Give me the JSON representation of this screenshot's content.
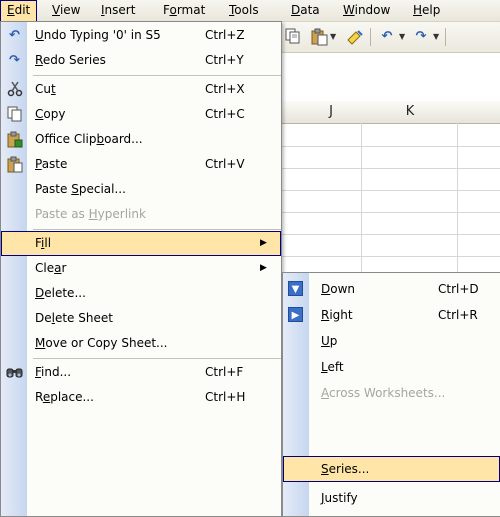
{
  "menubar": {
    "items": [
      {
        "pre": "",
        "key": "E",
        "post": "dit"
      },
      {
        "pre": "",
        "key": "V",
        "post": "iew"
      },
      {
        "pre": "",
        "key": "I",
        "post": "nsert"
      },
      {
        "pre": "F",
        "key": "o",
        "post": "rmat"
      },
      {
        "pre": "",
        "key": "T",
        "post": "ools"
      },
      {
        "pre": "",
        "key": "D",
        "post": "ata"
      },
      {
        "pre": "",
        "key": "W",
        "post": "indow"
      },
      {
        "pre": "",
        "key": "H",
        "post": "elp"
      }
    ]
  },
  "sheet": {
    "columns": [
      "J",
      "K"
    ]
  },
  "edit_menu": {
    "items": [
      {
        "icon": "undo-icon",
        "pre": "",
        "key": "U",
        "post": "ndo Typing '0' in S5",
        "shortcut": "Ctrl+Z"
      },
      {
        "icon": "redo-icon",
        "pre": "",
        "key": "R",
        "post": "edo Series",
        "shortcut": "Ctrl+Y"
      },
      {
        "icon": "cut-icon",
        "pre": "Cu",
        "key": "t",
        "post": "",
        "shortcut": "Ctrl+X"
      },
      {
        "icon": "copy-icon",
        "pre": "",
        "key": "C",
        "post": "opy",
        "shortcut": "Ctrl+C"
      },
      {
        "icon": "office-clipboard-icon",
        "pre": "Office Clip",
        "key": "b",
        "post": "oard...",
        "shortcut": ""
      },
      {
        "icon": "paste-icon",
        "pre": "",
        "key": "P",
        "post": "aste",
        "shortcut": "Ctrl+V"
      },
      {
        "icon": "",
        "pre": "Paste ",
        "key": "S",
        "post": "pecial...",
        "shortcut": ""
      },
      {
        "icon": "",
        "pre": "Paste as ",
        "key": "H",
        "post": "yperlink",
        "shortcut": "",
        "disabled": true
      },
      {
        "icon": "",
        "pre": "F",
        "key": "i",
        "post": "ll",
        "shortcut": "",
        "submenu": true,
        "highlighted": true
      },
      {
        "icon": "",
        "pre": "Cle",
        "key": "a",
        "post": "r",
        "shortcut": "",
        "submenu": true
      },
      {
        "icon": "",
        "pre": "",
        "key": "D",
        "post": "elete...",
        "shortcut": ""
      },
      {
        "icon": "",
        "pre": "De",
        "key": "l",
        "post": "ete Sheet",
        "shortcut": ""
      },
      {
        "icon": "",
        "pre": "",
        "key": "M",
        "post": "ove or Copy Sheet...",
        "shortcut": ""
      },
      {
        "icon": "find-icon",
        "pre": "",
        "key": "F",
        "post": "ind...",
        "shortcut": "Ctrl+F"
      },
      {
        "icon": "",
        "pre": "R",
        "key": "e",
        "post": "place...",
        "shortcut": "Ctrl+H"
      }
    ]
  },
  "fill_submenu": {
    "items": [
      {
        "icon": "fill-down-icon",
        "pre": "",
        "key": "D",
        "post": "own",
        "shortcut": "Ctrl+D"
      },
      {
        "icon": "fill-right-icon",
        "pre": "",
        "key": "R",
        "post": "ight",
        "shortcut": "Ctrl+R"
      },
      {
        "icon": "",
        "pre": "",
        "key": "U",
        "post": "p",
        "shortcut": ""
      },
      {
        "icon": "",
        "pre": "",
        "key": "L",
        "post": "eft",
        "shortcut": ""
      },
      {
        "icon": "",
        "pre": "",
        "key": "A",
        "post": "cross Worksheets...",
        "shortcut": "",
        "disabled": true
      },
      {
        "icon": "",
        "pre": "",
        "key": "S",
        "post": "eries...",
        "shortcut": "",
        "highlighted": true
      },
      {
        "icon": "",
        "pre": "",
        "key": "J",
        "post": "ustify",
        "shortcut": ""
      }
    ]
  },
  "colors": {
    "highlight": "#ffe6a8",
    "highlight_border": "#000080",
    "menu_strip": "#c6d6ef",
    "disabled_text": "#a5a5a0"
  }
}
